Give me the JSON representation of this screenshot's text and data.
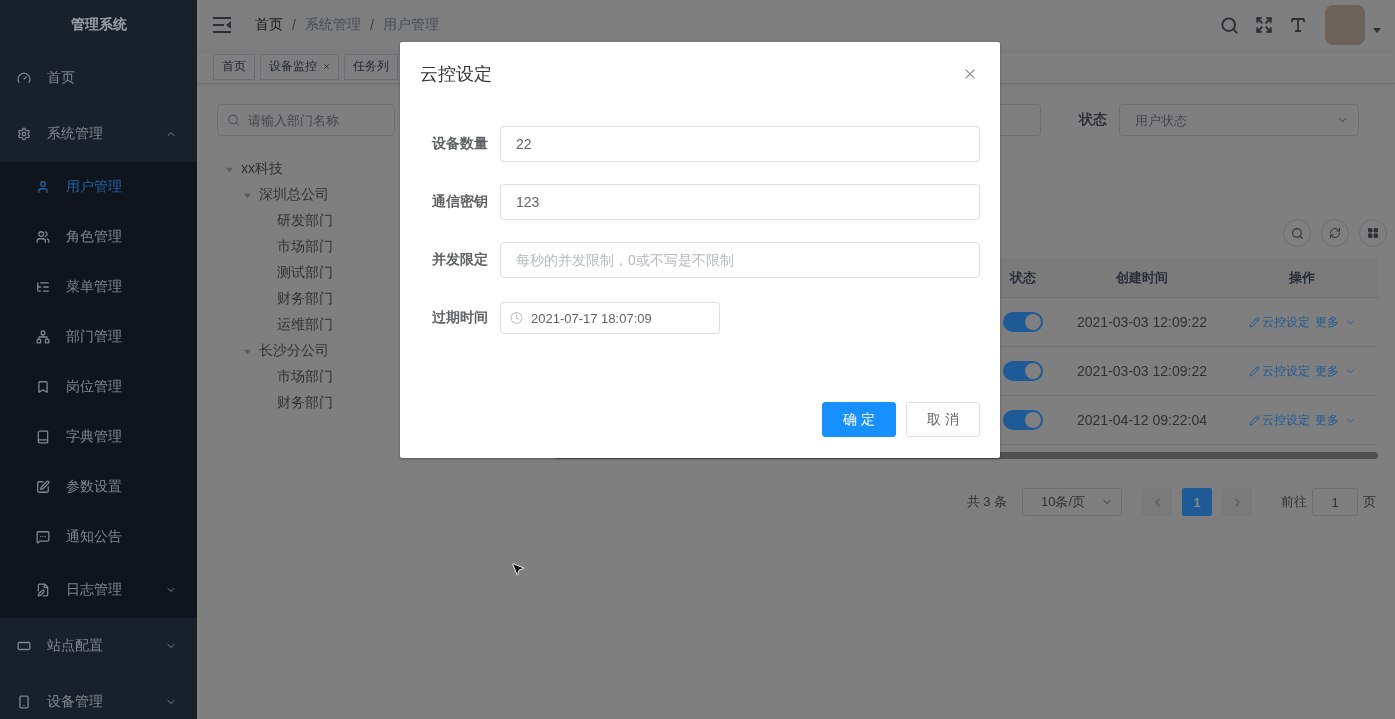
{
  "sidebar": {
    "title": "管理系统",
    "items": [
      {
        "label": "首页",
        "selected": false
      },
      {
        "label": "系统管理",
        "selected": false,
        "expanded": true,
        "children": [
          {
            "label": "用户管理",
            "selected": true
          },
          {
            "label": "角色管理",
            "selected": false
          },
          {
            "label": "菜单管理",
            "selected": false
          },
          {
            "label": "部门管理",
            "selected": false
          },
          {
            "label": "岗位管理",
            "selected": false
          },
          {
            "label": "字典管理",
            "selected": false
          },
          {
            "label": "参数设置",
            "selected": false
          },
          {
            "label": "通知公告",
            "selected": false
          },
          {
            "label": "日志管理",
            "selected": false,
            "expanded": false
          }
        ]
      },
      {
        "label": "站点配置",
        "selected": false,
        "expanded": false
      },
      {
        "label": "设备管理",
        "selected": false,
        "expanded": false
      }
    ]
  },
  "breadcrumb": {
    "separator": "/",
    "items": [
      {
        "label": "首页",
        "link": true
      },
      {
        "label": "系统管理",
        "link": false
      },
      {
        "label": "用户管理",
        "link": false
      }
    ]
  },
  "tags": [
    {
      "label": "首页",
      "selected": false,
      "closable": false
    },
    {
      "label": "设备监控",
      "selected": false,
      "closable": true
    },
    {
      "label": "任务列",
      "selected": false,
      "closable": false
    }
  ],
  "dept_tree": {
    "search": {
      "placeholder": "请输入部门名称"
    },
    "nodes": [
      {
        "label": "xx科技",
        "expanded": true,
        "children": [
          {
            "label": "深圳总公司",
            "expanded": true,
            "children": [
              {
                "label": "研发部门"
              },
              {
                "label": "市场部门"
              },
              {
                "label": "测试部门"
              },
              {
                "label": "财务部门"
              },
              {
                "label": "运维部门"
              }
            ]
          },
          {
            "label": "长沙分公司",
            "expanded": true,
            "children": [
              {
                "label": "市场部门"
              },
              {
                "label": "财务部门"
              }
            ]
          }
        ]
      }
    ]
  },
  "search_form": {
    "fields": [
      {
        "kind": "input"
      },
      {
        "kind": "select",
        "label": "状态",
        "placeholder": "用户状态"
      }
    ]
  },
  "table": {
    "columns": [
      "状态",
      "创建时间",
      "操作"
    ],
    "rows": [
      {
        "enabled": true,
        "created": "2021-03-03 12:09:22",
        "actions": [
          {
            "kind": "edit",
            "label": "云控设定"
          },
          {
            "kind": "dropdown",
            "label": "更多"
          }
        ]
      },
      {
        "enabled": true,
        "created": "2021-03-03 12:09:22",
        "actions": [
          {
            "kind": "edit",
            "label": "云控设定"
          },
          {
            "kind": "dropdown",
            "label": "更多"
          }
        ]
      },
      {
        "enabled": true,
        "created": "2021-04-12 09:22:04",
        "actions": [
          {
            "kind": "edit",
            "label": "云控设定"
          },
          {
            "kind": "dropdown",
            "label": "更多"
          }
        ]
      }
    ]
  },
  "pagination": {
    "total": "共 3 条",
    "page_size": "10条/页",
    "prev": {
      "disabled": true
    },
    "pages": [
      {
        "label": "1",
        "selected": true
      }
    ],
    "next": {
      "disabled": true
    },
    "jump_label": "前往",
    "jump_value": "1",
    "jump_suffix": "页"
  },
  "modal": {
    "title": "云控设定",
    "fields": [
      {
        "kind": "text",
        "label": "设备数量",
        "value": "22"
      },
      {
        "kind": "text",
        "label": "通信密钥",
        "value": "123"
      },
      {
        "kind": "text",
        "label": "并发限定",
        "placeholder": "每秒的并发限制，0或不写是不限制"
      },
      {
        "kind": "datetime",
        "label": "过期时间",
        "value": "2021-07-17 18:07:09"
      }
    ],
    "buttons": [
      {
        "kind": "primary",
        "label": "确 定"
      },
      {
        "kind": "default",
        "label": "取 消"
      }
    ]
  }
}
